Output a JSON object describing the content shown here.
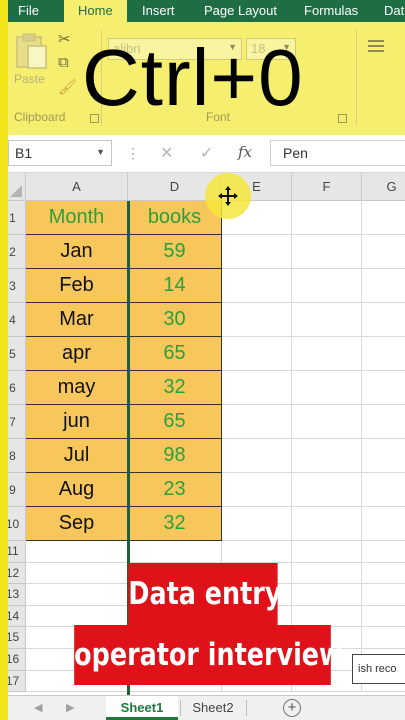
{
  "ribbon": {
    "tabs": [
      {
        "label": "File",
        "active": false
      },
      {
        "label": "Home",
        "active": true
      },
      {
        "label": "Insert",
        "active": false
      },
      {
        "label": "Page Layout",
        "active": false
      },
      {
        "label": "Formulas",
        "active": false
      },
      {
        "label": "Dat",
        "active": false
      }
    ],
    "clipboard": {
      "paste_label": "Paste",
      "group_label": "Clipboard"
    },
    "font": {
      "font_name": "alibri",
      "font_size": "18",
      "group_label": "Font"
    },
    "overlay_title": "Ctrl+0"
  },
  "formula_bar": {
    "name_box": "B1",
    "cancel_icon": "close-icon",
    "enter_icon": "check-icon",
    "fx_label": "fx",
    "content": "Pen"
  },
  "sheet": {
    "columns": [
      "A",
      "D",
      "E",
      "F",
      "G"
    ],
    "row_numbers": [
      "1",
      "2",
      "3",
      "4",
      "5",
      "6",
      "7",
      "8",
      "9",
      "10",
      "11",
      "12",
      "13",
      "14",
      "15",
      "16",
      "17"
    ],
    "headers": [
      "Month",
      "books"
    ],
    "rows": [
      {
        "month": "Jan",
        "books": "59"
      },
      {
        "month": "Feb",
        "books": "14"
      },
      {
        "month": "Mar",
        "books": "30"
      },
      {
        "month": "apr",
        "books": "65"
      },
      {
        "month": "may",
        "books": "32"
      },
      {
        "month": "jun",
        "books": "65"
      },
      {
        "month": "Jul",
        "books": "98"
      },
      {
        "month": "Aug",
        "books": "23"
      },
      {
        "month": "Sep",
        "books": "32"
      }
    ],
    "partial_text": "ish reco"
  },
  "banner": {
    "line1": "Data entry",
    "line2": "operator interview"
  },
  "sheet_tabs": [
    {
      "label": "Sheet1",
      "active": true
    },
    {
      "label": "Sheet2",
      "active": false
    }
  ],
  "colors": {
    "ribbon_bg": "#f5ee6e",
    "tab_bar": "#1f6e43",
    "data_fill": "#f7c75c",
    "books_text": "#2e9e3d",
    "banner_red": "#e01219"
  }
}
